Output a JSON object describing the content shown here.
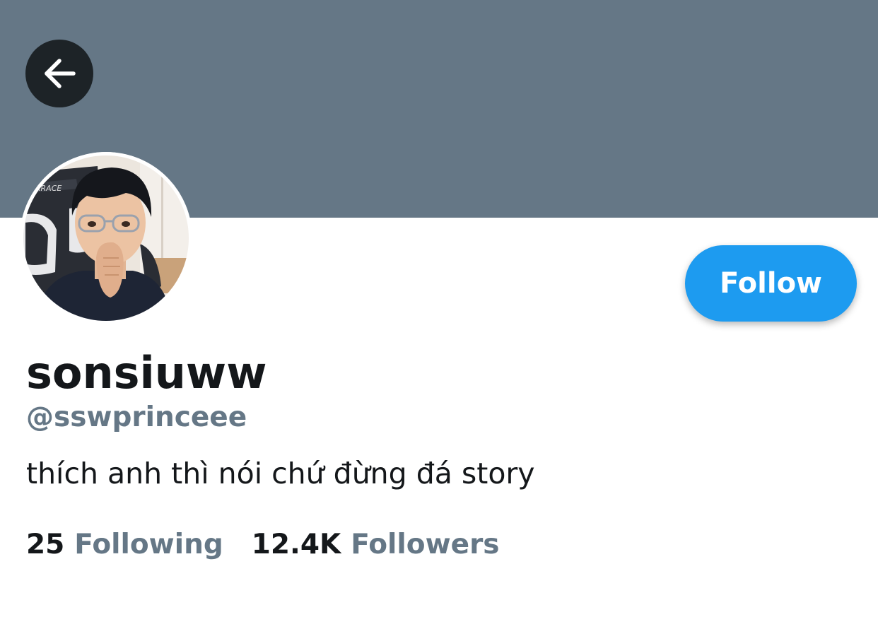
{
  "colors": {
    "banner": "#657786",
    "accent": "#1d9bf0",
    "secondary_text": "#657786",
    "primary_text": "#14171a",
    "back_button_bg": "#1d2327"
  },
  "header": {
    "back_icon": "arrow-left-icon"
  },
  "profile": {
    "avatar_icon": "avatar-photo",
    "display_name": "sonsiuww",
    "handle": "@sswprinceee",
    "bio": "thích anh thì nói chứ đừng đá story",
    "follow_label": "Follow"
  },
  "stats": {
    "following_count": "25",
    "following_label": "Following",
    "followers_count": "12.4K",
    "followers_label": "Followers"
  }
}
